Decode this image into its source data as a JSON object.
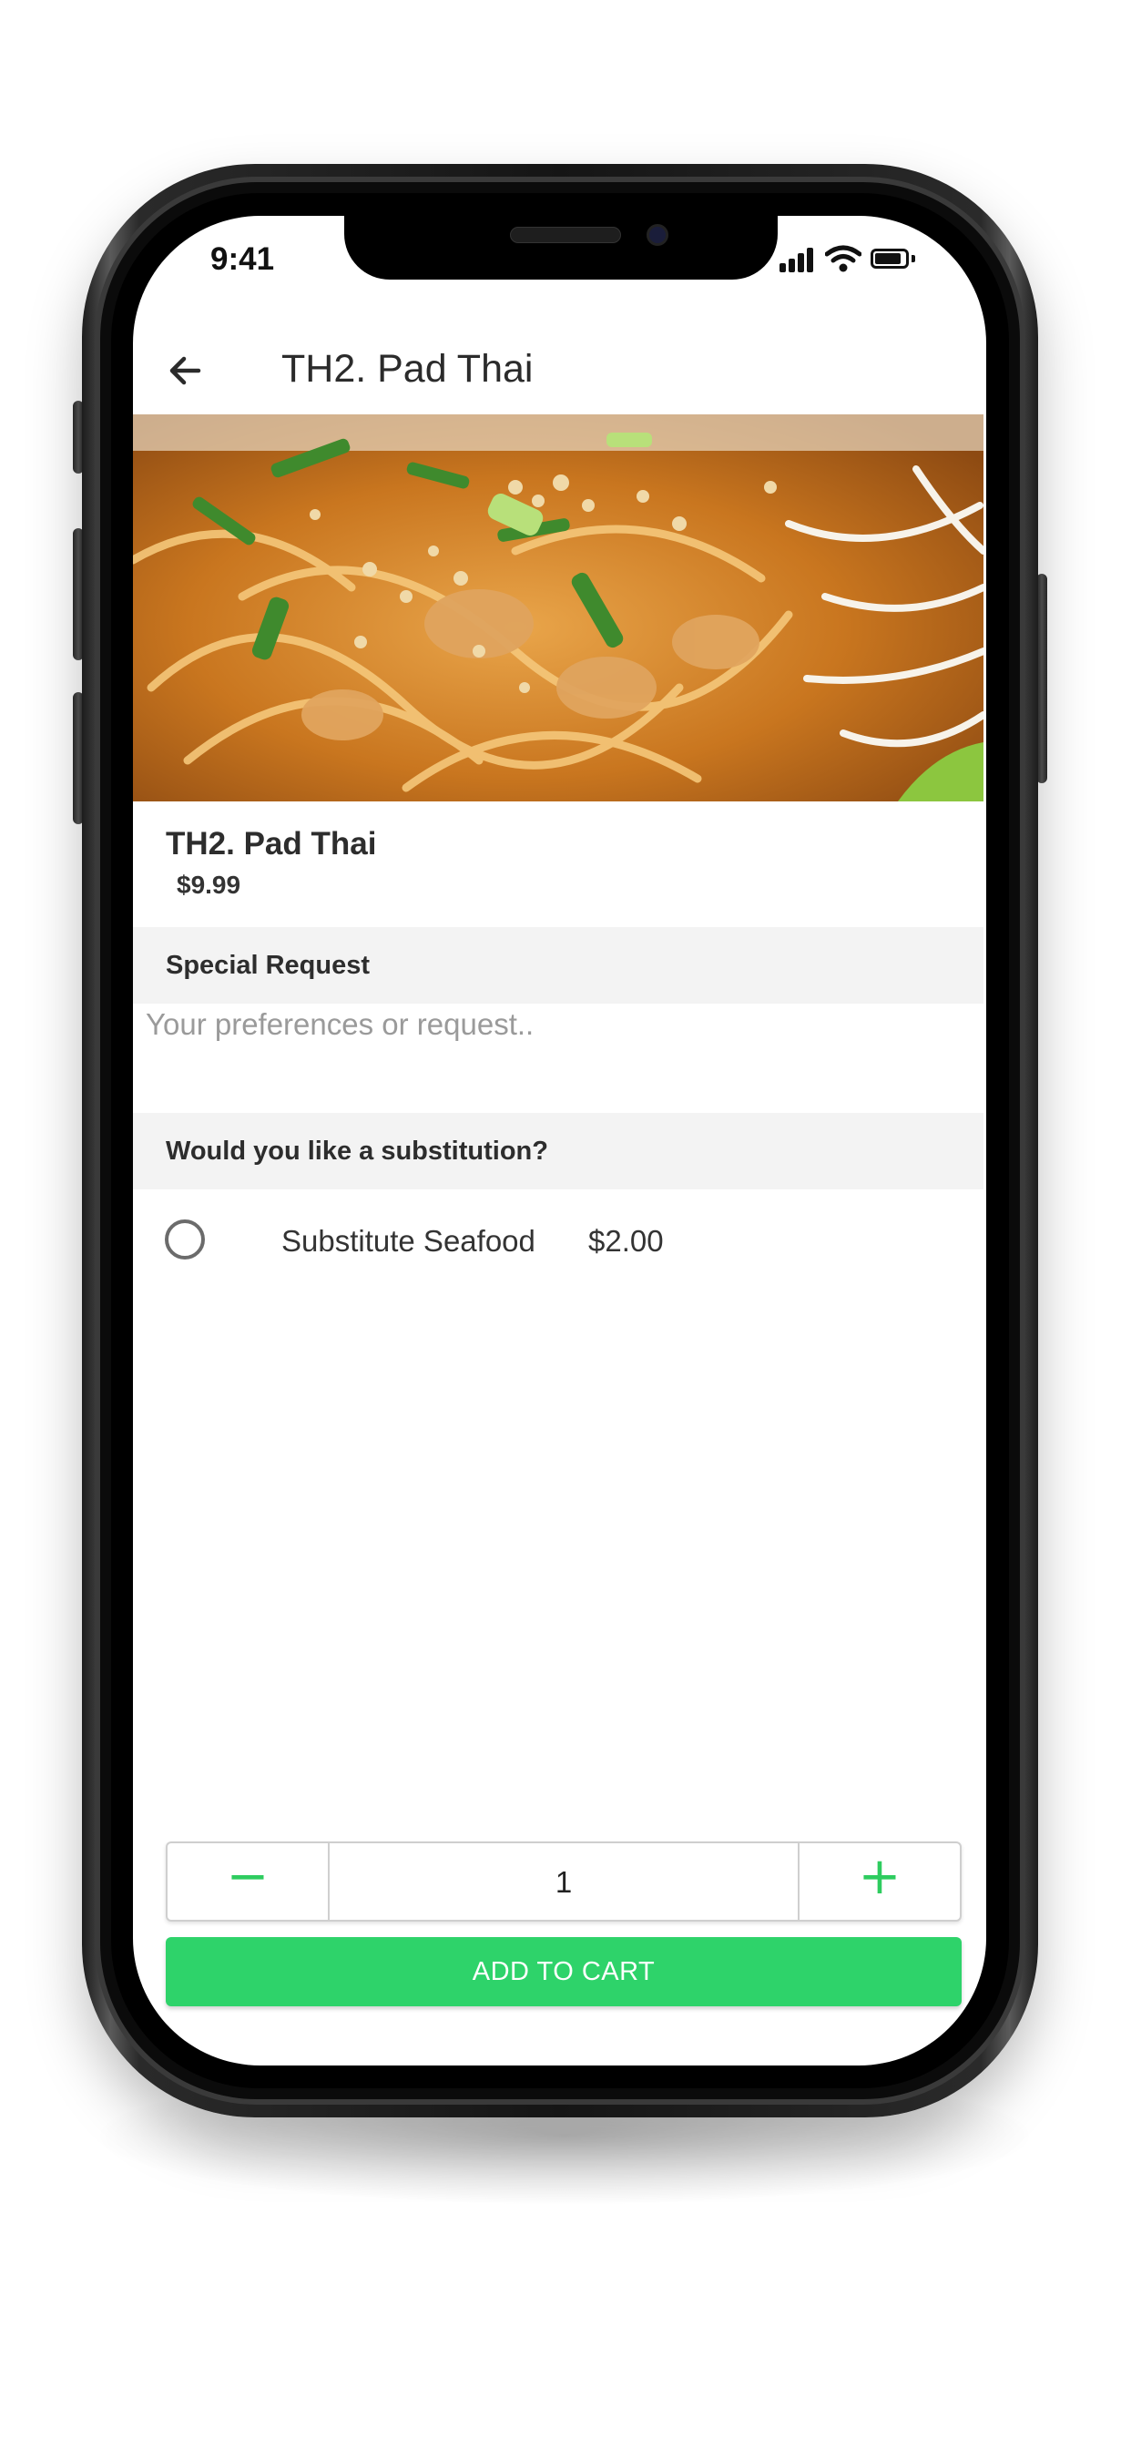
{
  "status_bar": {
    "time": "9:41"
  },
  "header": {
    "title": "TH2. Pad Thai",
    "back_icon": "arrow-left-icon"
  },
  "item": {
    "name": "TH2. Pad Thai",
    "price": "$9.99",
    "image": "pad-thai-photo"
  },
  "special_request": {
    "label": "Special Request",
    "placeholder": "Your preferences or request..",
    "value": ""
  },
  "substitution": {
    "label": "Would you like a substitution?",
    "options": [
      {
        "label": "Substitute Seafood",
        "price": "$2.00",
        "selected": false
      }
    ]
  },
  "quantity": {
    "value": "1",
    "minus": "−",
    "plus": "+"
  },
  "add_to_cart": {
    "label": "ADD TO CART"
  },
  "colors": {
    "accent": "#2ed36a",
    "section_bg": "#f3f3f3",
    "text": "#2d2d2d"
  }
}
